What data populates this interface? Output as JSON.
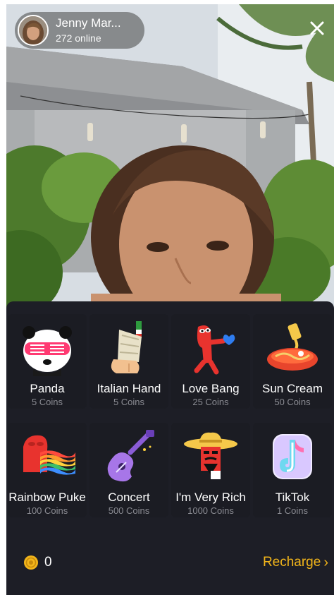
{
  "host": {
    "name": "Jenny Mar...",
    "online": "272 online"
  },
  "close_label": "",
  "gifts": [
    {
      "name": "Panda",
      "price": "5 Coins",
      "icon": "panda-icon"
    },
    {
      "name": "Italian Hand",
      "price": "5 Coins",
      "icon": "italian-hand-icon"
    },
    {
      "name": "Love Bang",
      "price": "25 Coins",
      "icon": "love-bang-icon"
    },
    {
      "name": "Sun Cream",
      "price": "50 Coins",
      "icon": "sun-cream-icon"
    },
    {
      "name": "Rainbow Puke",
      "price": "100 Coins",
      "icon": "rainbow-puke-icon"
    },
    {
      "name": "Concert",
      "price": "500 Coins",
      "icon": "guitar-icon"
    },
    {
      "name": "I'm Very Rich",
      "price": "1000 Coins",
      "icon": "rich-cowboy-icon"
    },
    {
      "name": "TikTok",
      "price": "1 Coins",
      "icon": "tiktok-icon"
    }
  ],
  "wallet": {
    "balance": "0",
    "recharge_label": "Recharge"
  },
  "colors": {
    "panel_bg": "#1d1e26",
    "recharge": "#f2b51a",
    "price_text": "#8a8b92"
  }
}
